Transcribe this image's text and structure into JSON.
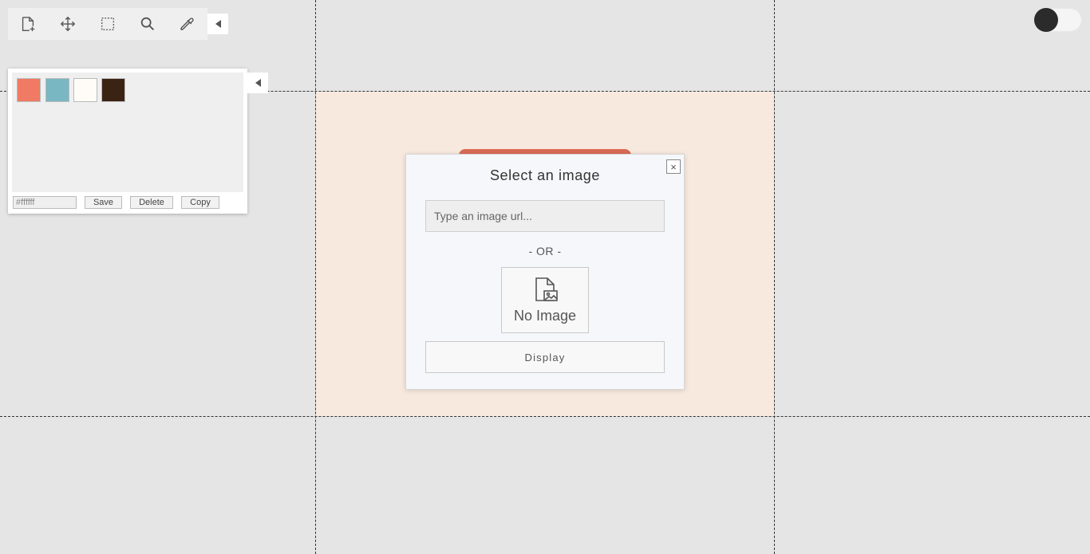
{
  "canvas": {
    "background_color": "#e5e5e5",
    "artboard_color": "#f8e9de",
    "guide_color": "#333333"
  },
  "toolbar": {
    "tools": [
      {
        "name": "new-file",
        "icon": "file-plus-icon"
      },
      {
        "name": "move",
        "icon": "move-arrows-icon"
      },
      {
        "name": "marquee-select",
        "icon": "dashed-rectangle-icon"
      },
      {
        "name": "zoom",
        "icon": "search-icon"
      },
      {
        "name": "eyedropper",
        "icon": "eyedropper-icon"
      }
    ],
    "collapse_icon": "triangle-left-icon"
  },
  "palette": {
    "swatches": [
      "#f07a63",
      "#79b7c2",
      "#fffcf7",
      "#3b2314"
    ],
    "hex_value": "#ffffff",
    "save_label": "Save",
    "delete_label": "Delete",
    "copy_label": "Copy",
    "collapse_icon": "triangle-left-icon"
  },
  "theme_toggle": {
    "state": "off",
    "knob_color": "#2b2b2b"
  },
  "modal": {
    "title": "Select an image",
    "close_symbol": "×",
    "url_placeholder": "Type an image url...",
    "url_value": "",
    "or_text": "- OR -",
    "no_image_label": "No Image",
    "display_label": "Display",
    "accent_color": "#d96a55"
  }
}
